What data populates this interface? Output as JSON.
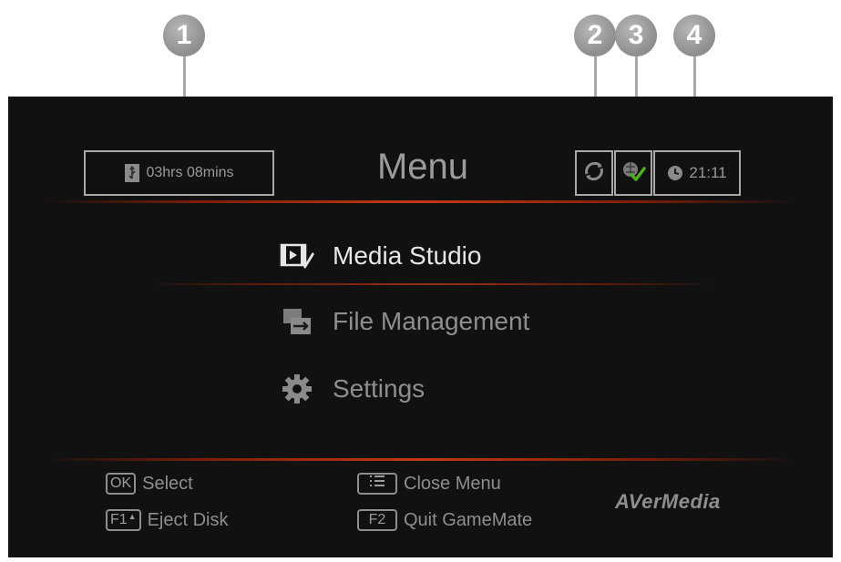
{
  "callouts": [
    "1",
    "2",
    "3",
    "4"
  ],
  "status_bar": {
    "record_time": "03hrs 08mins",
    "clock": "21:11"
  },
  "menu": {
    "title": "Menu",
    "items": [
      {
        "label": "Media Studio",
        "icon": "media-studio-icon",
        "selected": true
      },
      {
        "label": "File Management",
        "icon": "file-management-icon",
        "selected": false
      },
      {
        "label": "Settings",
        "icon": "gear-icon",
        "selected": false
      }
    ]
  },
  "footer": {
    "ok_key": "OK",
    "ok_label": "Select",
    "f1_key": "F1",
    "f1_label": "Eject Disk",
    "menu_label": "Close Menu",
    "f2_key": "F2",
    "f2_label": "Quit GameMate",
    "brand": "AVerMedia"
  },
  "colors": {
    "screen_bg": "#111111",
    "selected_text": "#e6e6e6",
    "dim_text": "#8e8e8e",
    "accent_glow": "#c43a12",
    "check_green": "#4caf1c"
  }
}
